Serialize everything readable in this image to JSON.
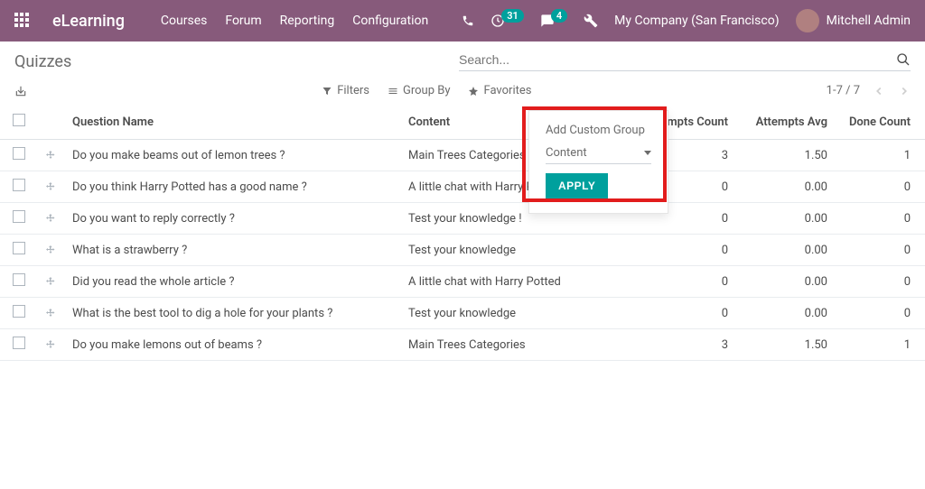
{
  "navbar": {
    "brand": "eLearning",
    "links": [
      "Courses",
      "Forum",
      "Reporting",
      "Configuration"
    ],
    "activities_count": "31",
    "messages_count": "4",
    "company": "My Company (San Francisco)",
    "user": "Mitchell Admin"
  },
  "page": {
    "title": "Quizzes",
    "search_placeholder": "Search..."
  },
  "search_options": {
    "filters": "Filters",
    "group_by": "Group By",
    "favorites": "Favorites"
  },
  "pager": {
    "range": "1-7 / 7"
  },
  "dropdown": {
    "title": "Add Custom Group",
    "selected": "Content",
    "apply": "APPLY"
  },
  "table": {
    "headers": {
      "question": "Question Name",
      "content": "Content",
      "attempts_count": "Attempts Count",
      "attempts_avg": "Attempts Avg",
      "done_count": "Done Count"
    },
    "rows": [
      {
        "question": "Do you make beams out of lemon trees ?",
        "content": "Main Trees Categories",
        "attempts_count": "3",
        "attempts_avg": "1.50",
        "done_count": "1"
      },
      {
        "question": "Do you think Harry Potted has a good name ?",
        "content": "A little chat with Harry Potted",
        "attempts_count": "0",
        "attempts_avg": "0.00",
        "done_count": "0"
      },
      {
        "question": "Do you want to reply correctly ?",
        "content": "Test your knowledge !",
        "attempts_count": "0",
        "attempts_avg": "0.00",
        "done_count": "0"
      },
      {
        "question": "What is a strawberry ?",
        "content": "Test your knowledge",
        "attempts_count": "0",
        "attempts_avg": "0.00",
        "done_count": "0"
      },
      {
        "question": "Did you read the whole article ?",
        "content": "A little chat with Harry Potted",
        "attempts_count": "0",
        "attempts_avg": "0.00",
        "done_count": "0"
      },
      {
        "question": "What is the best tool to dig a hole for your plants ?",
        "content": "Test your knowledge",
        "attempts_count": "0",
        "attempts_avg": "0.00",
        "done_count": "0"
      },
      {
        "question": "Do you make lemons out of beams ?",
        "content": "Main Trees Categories",
        "attempts_count": "3",
        "attempts_avg": "1.50",
        "done_count": "1"
      }
    ]
  }
}
